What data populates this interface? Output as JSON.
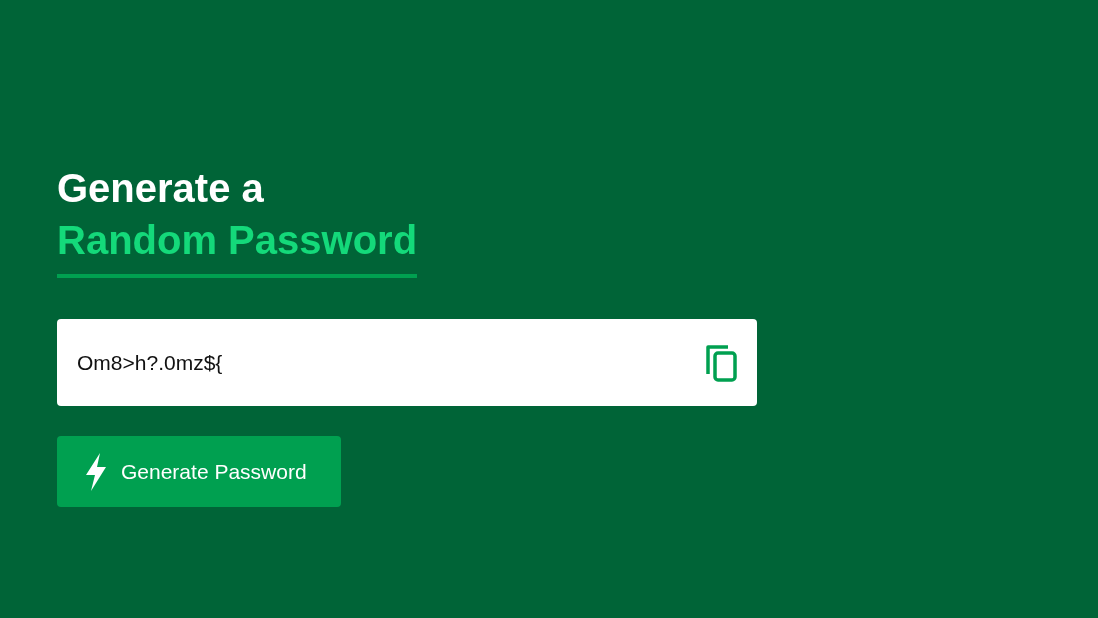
{
  "heading": {
    "line_1": "Generate a",
    "line_2": "Random Password"
  },
  "password_field": {
    "value": "Om8>h?.0mz${"
  },
  "generate_button": {
    "label": "Generate Password"
  }
}
